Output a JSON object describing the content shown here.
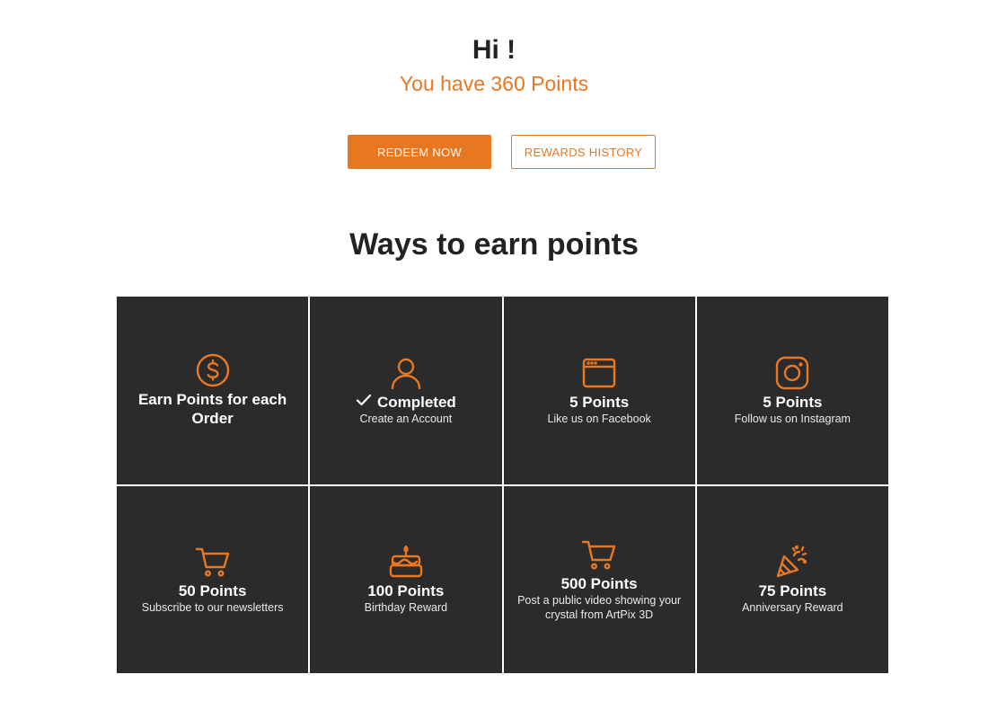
{
  "header": {
    "greeting": "Hi !",
    "points_text": "You have 360 Points"
  },
  "actions": {
    "redeem_label": "REDEEM NOW",
    "history_label": "REWARDS HISTORY"
  },
  "earn": {
    "title": "Ways to earn points",
    "tiles": [
      {
        "icon": "dollar-circle-icon",
        "title": "Earn Points for each Order",
        "subtitle": ""
      },
      {
        "icon": "user-icon",
        "title": "Completed",
        "subtitle": "Create an Account",
        "completed": true
      },
      {
        "icon": "browser-window-icon",
        "title": "5 Points",
        "subtitle": "Like us on Facebook"
      },
      {
        "icon": "instagram-icon",
        "title": "5 Points",
        "subtitle": "Follow us on Instagram"
      },
      {
        "icon": "shopping-cart-icon",
        "title": "50 Points",
        "subtitle": "Subscribe to our newsletters"
      },
      {
        "icon": "birthday-cake-icon",
        "title": "100 Points",
        "subtitle": "Birthday Reward"
      },
      {
        "icon": "shopping-cart-icon",
        "title": "500 Points",
        "subtitle": "Post a public video showing your crystal from ArtPix 3D"
      },
      {
        "icon": "party-popper-icon",
        "title": "75 Points",
        "subtitle": "Anniversary Reward"
      }
    ]
  },
  "colors": {
    "accent": "#e87722",
    "tile_background": "#2b2b2b",
    "text_dark": "#222222"
  }
}
